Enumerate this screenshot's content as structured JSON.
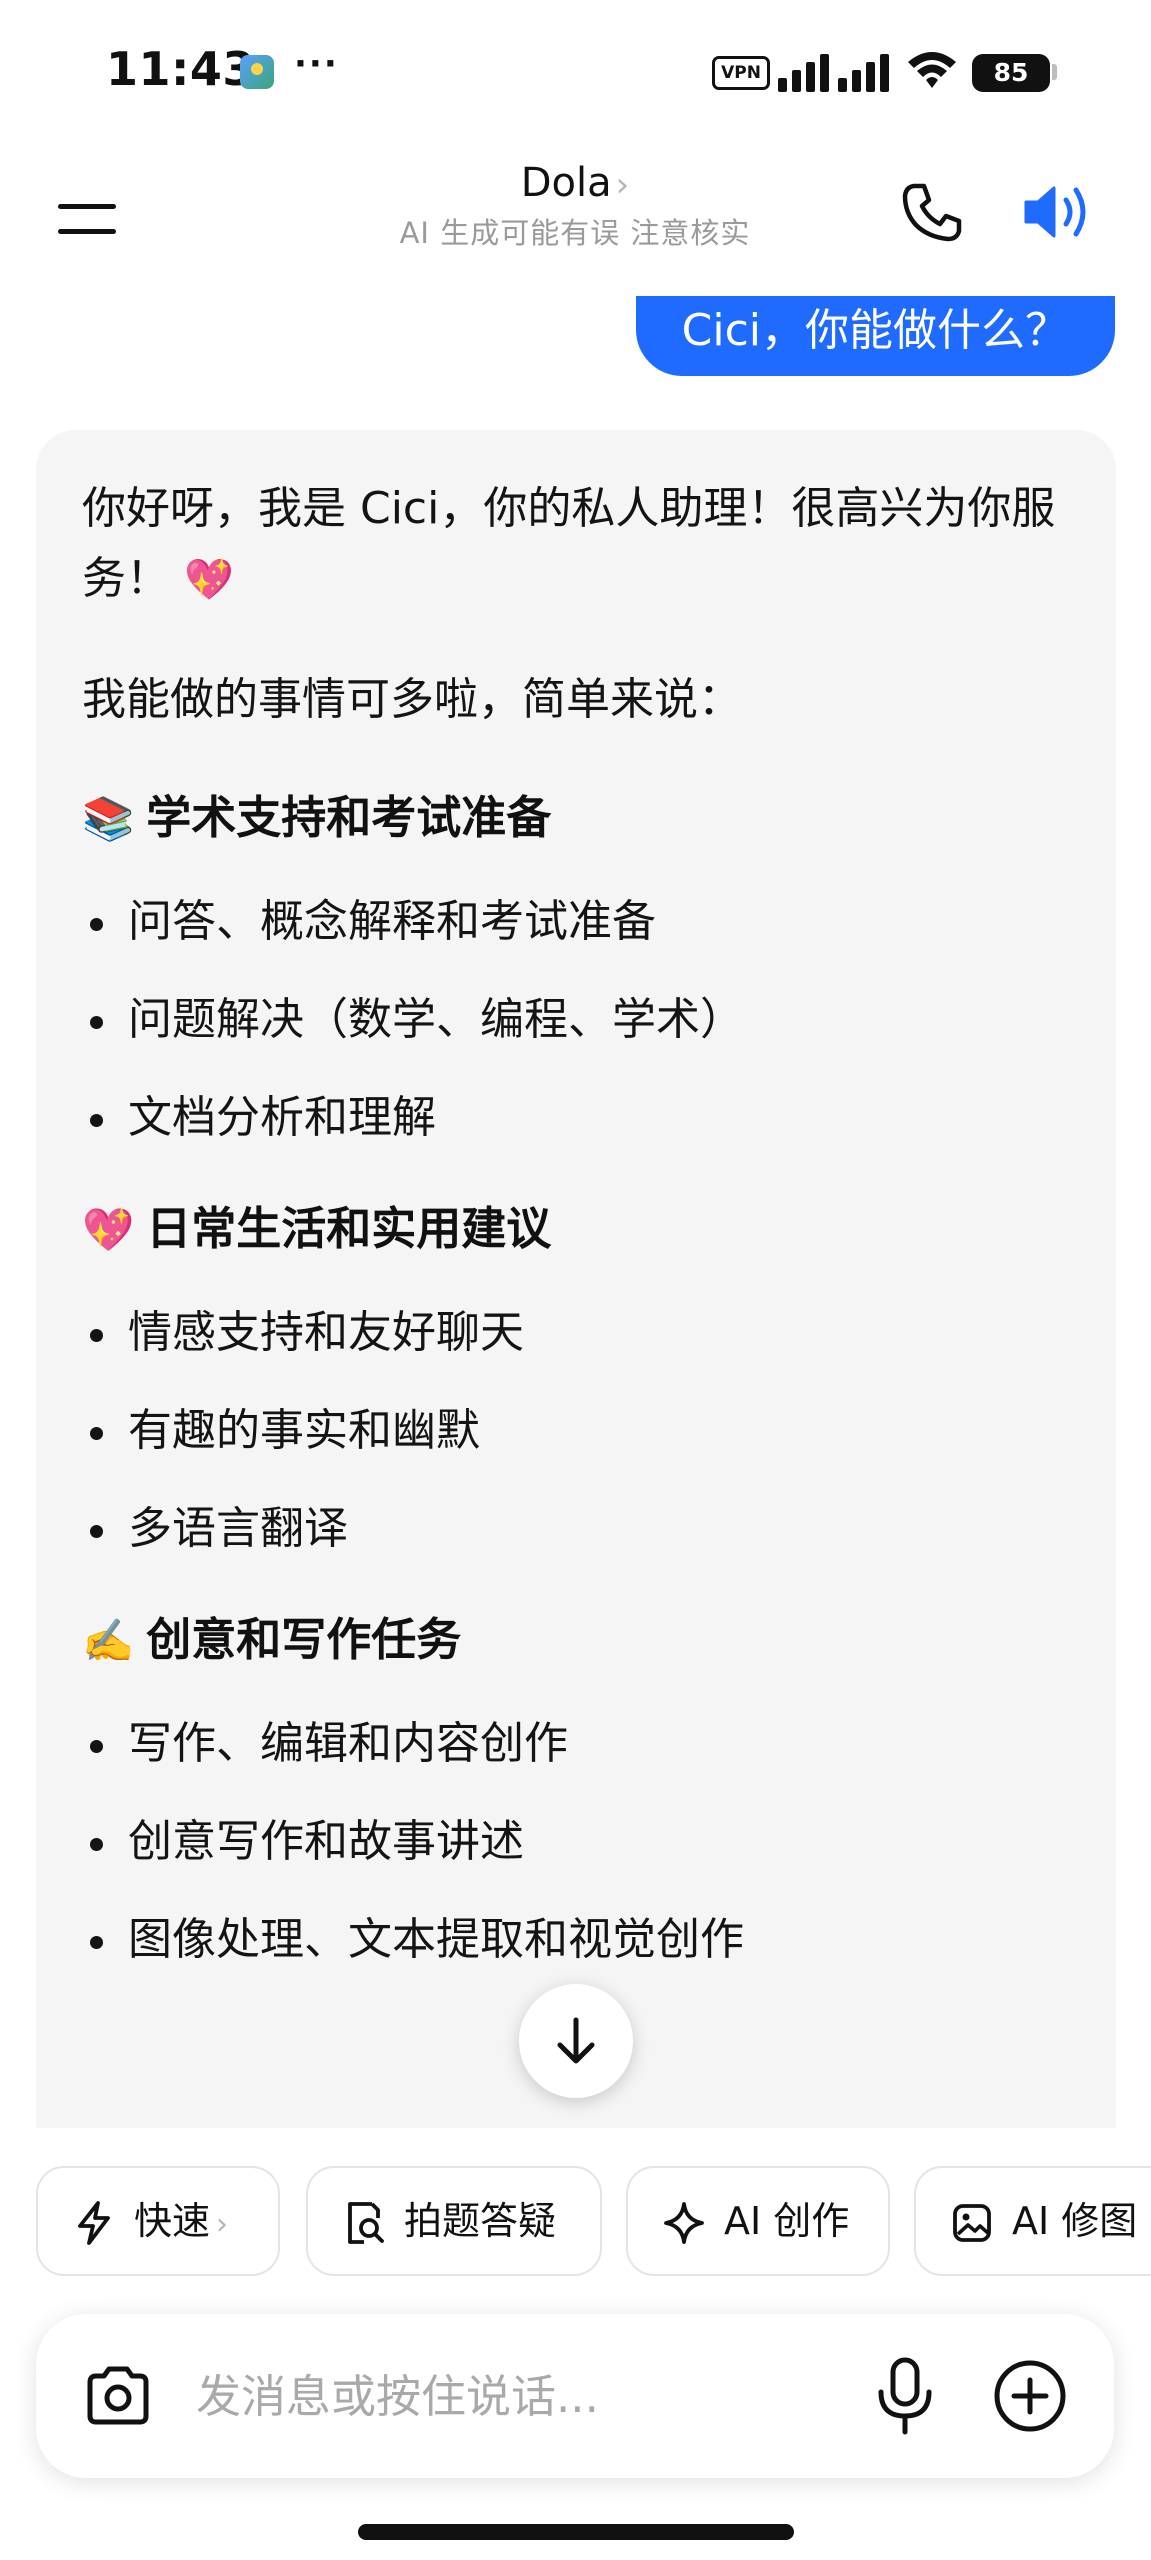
{
  "status_bar": {
    "time": "11:43",
    "more": "···",
    "vpn": "VPN",
    "battery": "85"
  },
  "header": {
    "title": "Dola",
    "title_chevron": "›",
    "subtitle": "AI 生成可能有误 注意核实"
  },
  "chat": {
    "user_message": "Cici，你能做什么？",
    "assistant": {
      "intro": "你好呀，我是 Cici，你的私人助理！很高兴为你服务！",
      "intro_emoji": "💖",
      "lead": "我能做的事情可多啦，简单来说：",
      "sections": [
        {
          "emoji": "📚",
          "title": "学术支持和考试准备",
          "items": [
            "问答、概念解释和考试准备",
            "问题解决（数学、编程、学术）",
            "文档分析和理解"
          ]
        },
        {
          "emoji": "💖",
          "title": "日常生活和实用建议",
          "items": [
            "情感支持和友好聊天",
            "有趣的事实和幽默",
            "多语言翻译"
          ]
        },
        {
          "emoji": "✍️",
          "title": "创意和写作任务",
          "items": [
            "写作、编辑和内容创作",
            "创意写作和故事讲述",
            "图像处理、文本提取和视觉创作"
          ]
        }
      ]
    }
  },
  "quick_actions": [
    {
      "label": "快速",
      "chevron": "›",
      "icon": "lightning-icon"
    },
    {
      "label": "拍题答疑",
      "icon": "photo-search-icon"
    },
    {
      "label": "AI 创作",
      "icon": "sparkle-icon"
    },
    {
      "label": "AI 修图",
      "icon": "image-edit-icon"
    }
  ],
  "input": {
    "placeholder": "发消息或按住说话..."
  },
  "colors": {
    "accent": "#1f6bff",
    "card_bg": "#f5f5f5",
    "muted_text": "#9a9a9a"
  }
}
